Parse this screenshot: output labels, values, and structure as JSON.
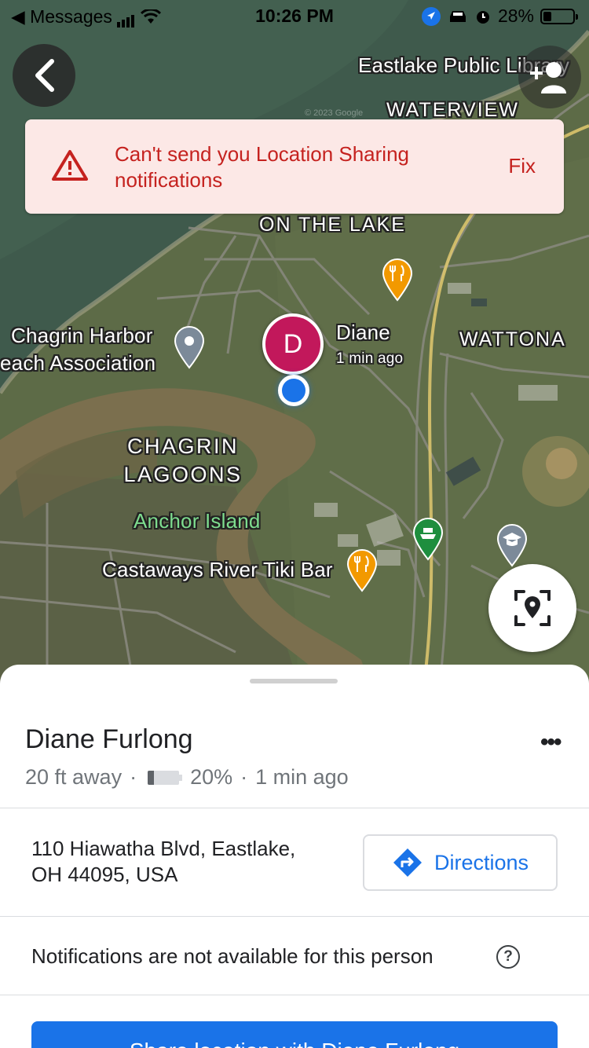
{
  "status_bar": {
    "back_app": "◀ Messages",
    "time": "10:26 PM",
    "battery_percent": "28%",
    "battery_level": 0.28,
    "icons": [
      "signal-icon",
      "wifi-icon",
      "location-arrow-icon",
      "car-icon",
      "alarm-icon",
      "battery-icon"
    ]
  },
  "map": {
    "labels": {
      "eastlake_library": "Eastlake Public Library",
      "waterview": "WATERVIEW",
      "on_the_lake": "ON THE LAKE",
      "chagrin_harbor_1": "Chagrin Harbor",
      "chagrin_harbor_2": "each Association",
      "wattona": "WATTONA",
      "chagrin_lagoons_1": "CHAGRIN",
      "chagrin_lagoons_2": "LAGOONS",
      "anchor_island": "Anchor Island",
      "castaways": "Castaways River Tiki Bar",
      "copyright": "© 2023 Google"
    },
    "person_marker": {
      "initial": "D",
      "label_name": "Diane",
      "label_time": "1 min ago",
      "color": "#c2185b"
    },
    "pins": [
      "restaurant-pin-icon",
      "place-pin-icon",
      "restaurant-pin-icon",
      "ferry-pin-icon",
      "school-pin-icon"
    ]
  },
  "alert": {
    "message": "Can't send you Location Sharing notifications",
    "action": "Fix",
    "color": "#c5221f",
    "background": "#fce8e6"
  },
  "sheet": {
    "name": "Diane Furlong",
    "more": "•••",
    "distance": "20 ft away",
    "separator": "·",
    "battery": "20%",
    "battery_level": 0.2,
    "last_seen": "1 min ago",
    "address_line1": "110 Hiawatha Blvd, Eastlake,",
    "address_line2": "OH 44095, USA",
    "directions_label": "Directions",
    "notifications_text": "Notifications are not available for this person",
    "help": "?",
    "share_label": "Share location with Diane Furlong",
    "accent": "#1a73e8"
  }
}
